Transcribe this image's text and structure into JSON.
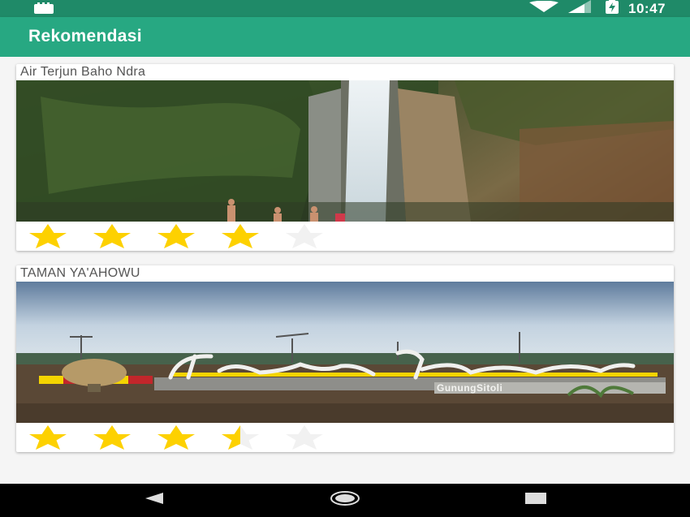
{
  "status_bar": {
    "time": "10:47",
    "icons": [
      "notification-icon",
      "wifi-icon",
      "signal-icon",
      "battery-charging-icon"
    ]
  },
  "app_bar": {
    "title": "Rekomendasi"
  },
  "places": [
    {
      "name": "Air Terjun Baho Ndra",
      "rating": 4,
      "max_rating": 5
    },
    {
      "name": "TAMAN YA'AHOWU",
      "rating": 3.5,
      "max_rating": 5
    }
  ],
  "nav_bar": {
    "icons": [
      "back-icon",
      "home-icon",
      "recents-icon"
    ]
  },
  "colors": {
    "primary": "#27a882",
    "primary_dark": "#1f8a68",
    "star_filled": "#fdd100",
    "star_empty": "#f1f1f1"
  }
}
